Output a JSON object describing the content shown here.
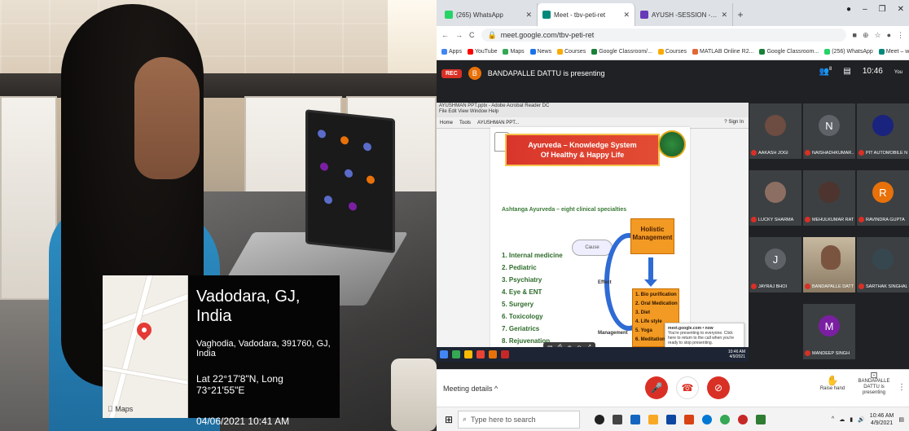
{
  "location_overlay": {
    "city": "Vadodara, GJ, India",
    "address": "Vaghodia, Vadodara, 391760, GJ, India",
    "coordinates": "Lat 22°17'8\"N, Long 73°21'55\"E",
    "datetime": "04/06/2021 10:41 AM",
    "map_brand": "Maps"
  },
  "browser": {
    "tabs": [
      {
        "label": "(265) WhatsApp",
        "color": "#25d366",
        "active": false
      },
      {
        "label": "Meet - tbv-peti-ret",
        "color": "#00897b",
        "active": true
      },
      {
        "label": "AYUSH -SESSION - Google Forms",
        "color": "#673ab7",
        "active": false
      }
    ],
    "new_tab": "+",
    "url": "meet.google.com/tbv-peti-ret",
    "bookmarks": [
      {
        "label": "Apps",
        "color": "#4285f4"
      },
      {
        "label": "YouTube",
        "color": "#ff0000"
      },
      {
        "label": "Maps",
        "color": "#34a853"
      },
      {
        "label": "News",
        "color": "#1a73e8"
      },
      {
        "label": "Courses",
        "color": "#f9ab00"
      },
      {
        "label": "Google Classroom/...",
        "color": "#188038"
      },
      {
        "label": "Courses",
        "color": "#f9ab00"
      },
      {
        "label": "MATLAB Online R2...",
        "color": "#e16737"
      },
      {
        "label": "Google Classroom...",
        "color": "#188038"
      },
      {
        "label": "(256) WhatsApp",
        "color": "#25d366"
      },
      {
        "label": "Meet – wuc-kktc-syp",
        "color": "#00897b"
      }
    ]
  },
  "meet": {
    "rec_label": "REC",
    "presenter_initial": "B",
    "presenting_text": "BANDAPALLE DATTU is presenting",
    "participant_count": "8",
    "time": "10:46",
    "you_label": "You",
    "shared_window": {
      "top_title": "AYUSHMAN PPT.pptx - Adobe Acrobat Reader DC",
      "menu": "File  Edit  View  Window  Help",
      "tabs": [
        "Home",
        "Tools",
        "AYUSHMAN PPT..."
      ],
      "sign_in": "Sign In",
      "slide": {
        "title_line1": "Ayurveda – Knowledge System",
        "title_line2": "Of Healthy & Happy Life",
        "subtitle": "Ashtanga Ayurveda – eight clinical specialties",
        "specialties": [
          "1. Internal medicine",
          "2. Pediatric",
          "3. Psychiatry",
          "4. Eye & ENT",
          "5. Surgery",
          "6. Toxicology",
          "7. Geriatrics",
          "8. Rejuvenation"
        ],
        "holistic": "Holistic Management",
        "cause": "Cause",
        "effect": "Effect",
        "management": "Management",
        "treatments": [
          "1. Bio purification",
          "2. Oral Medication",
          "3. Diet",
          "4. Life style",
          "5. Yoga",
          "6. Meditation"
        ]
      },
      "notice_title": "meet.google.com • now",
      "notice_body": "You're presenting to everyone. Click here to return to the call when you're ready to stop presenting.",
      "taskbar_clock": "10:46 AM\n4/9/2021"
    },
    "participants": [
      {
        "name": "AAKASH JOGI",
        "initial": "",
        "color": "#6d4c41",
        "video": false
      },
      {
        "name": "NAISHADHKUMAR...",
        "initial": "N",
        "color": "#5f6368",
        "video": false
      },
      {
        "name": "PIT AUTOMOBILE N...",
        "initial": "",
        "color": "#1a237e",
        "video": false
      },
      {
        "name": "LUCKY SHARMA",
        "initial": "",
        "color": "#8d6e63",
        "video": false
      },
      {
        "name": "MEHULKUMAR RAT...",
        "initial": "",
        "color": "#4e342e",
        "video": false
      },
      {
        "name": "RAVINDRA GUPTA",
        "initial": "R",
        "color": "#e8710a",
        "video": false
      },
      {
        "name": "JAYRAJ BHOI",
        "initial": "J",
        "color": "#5f6368",
        "video": false
      },
      {
        "name": "BANDAPALLE DATTU",
        "initial": "",
        "color": "#7b5440",
        "video": true
      },
      {
        "name": "SARTHAK SINGHAL",
        "initial": "",
        "color": "#37474f",
        "video": false
      },
      {
        "name": "MANDEEP SINGH",
        "initial": "M",
        "color": "#7b1fa2",
        "video": false
      }
    ],
    "meeting_details": "Meeting details",
    "raise_hand": "Raise hand",
    "presenting_now": "BANDAPALLE DATTU is presenting"
  },
  "taskbar": {
    "search_placeholder": "Type here to search",
    "time": "10:46 AM",
    "date": "4/9/2021"
  }
}
